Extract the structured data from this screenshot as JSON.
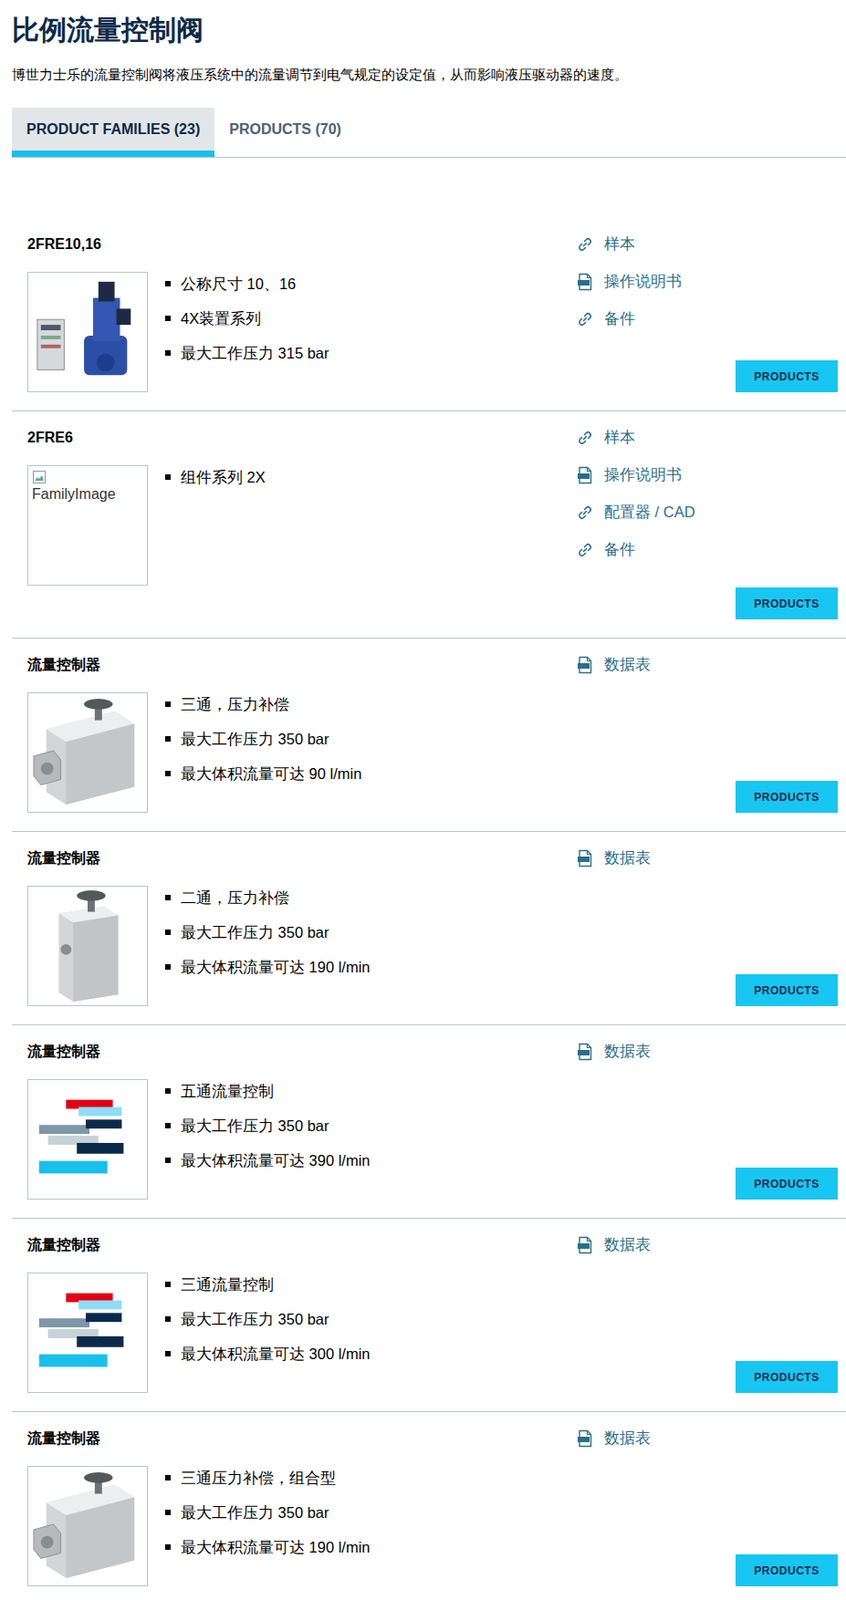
{
  "page": {
    "title": "比例流量控制阀",
    "description": "博世力士乐的流量控制阀将液压系统中的流量调节到电气规定的设定值，从而影响液压驱动器的速度。"
  },
  "tabs": [
    {
      "label": "PRODUCT FAMILIES (23)",
      "selected": true
    },
    {
      "label": "PRODUCTS (70)",
      "selected": false
    }
  ],
  "families": [
    {
      "name": "2FRE10,16",
      "image": {
        "kind": "valve",
        "alt": ""
      },
      "bullets": [
        "公称尺寸 10、16",
        "4X装置系列",
        "最大工作压力 315 bar"
      ],
      "links": [
        {
          "label": "样本",
          "kind": "link"
        },
        {
          "label": "操作说明书",
          "kind": "pdf"
        },
        {
          "label": "备件",
          "kind": "link"
        }
      ],
      "button": "PRODUCTS"
    },
    {
      "name": "2FRE6",
      "image": {
        "kind": "broken",
        "alt": "FamilyImage"
      },
      "bullets": [
        "组件系列 2X"
      ],
      "links": [
        {
          "label": "样本",
          "kind": "link"
        },
        {
          "label": "操作说明书",
          "kind": "pdf"
        },
        {
          "label": "配置器 / CAD",
          "kind": "link"
        },
        {
          "label": "备件",
          "kind": "link"
        }
      ],
      "button": "PRODUCTS"
    },
    {
      "name": "流量控制器",
      "image": {
        "kind": "block3",
        "alt": ""
      },
      "bullets": [
        "三通，压力补偿",
        "最大工作压力 350 bar",
        "最大体积流量可达 90 l/min"
      ],
      "links": [
        {
          "label": "数据表",
          "kind": "pdf"
        }
      ],
      "button": "PRODUCTS"
    },
    {
      "name": "流量控制器",
      "image": {
        "kind": "block2",
        "alt": ""
      },
      "bullets": [
        "二通，压力补偿",
        "最大工作压力 350 bar",
        "最大体积流量可达 190 l/min"
      ],
      "links": [
        {
          "label": "数据表",
          "kind": "pdf"
        }
      ],
      "button": "PRODUCTS"
    },
    {
      "name": "流量控制器",
      "image": {
        "kind": "stripes",
        "alt": ""
      },
      "bullets": [
        "五通流量控制",
        "最大工作压力 350 bar",
        "最大体积流量可达 390 l/min"
      ],
      "links": [
        {
          "label": "数据表",
          "kind": "pdf"
        }
      ],
      "button": "PRODUCTS"
    },
    {
      "name": "流量控制器",
      "image": {
        "kind": "stripes",
        "alt": ""
      },
      "bullets": [
        "三通流量控制",
        "最大工作压力 350 bar",
        "最大体积流量可达 300 l/min"
      ],
      "links": [
        {
          "label": "数据表",
          "kind": "pdf"
        }
      ],
      "button": "PRODUCTS"
    },
    {
      "name": "流量控制器",
      "image": {
        "kind": "block3",
        "alt": ""
      },
      "bullets": [
        "三通压力补偿，组合型",
        "最大工作压力 350 bar",
        "最大体积流量可达 190 l/min"
      ],
      "links": [
        {
          "label": "数据表",
          "kind": "pdf"
        }
      ],
      "button": "PRODUCTS"
    }
  ]
}
